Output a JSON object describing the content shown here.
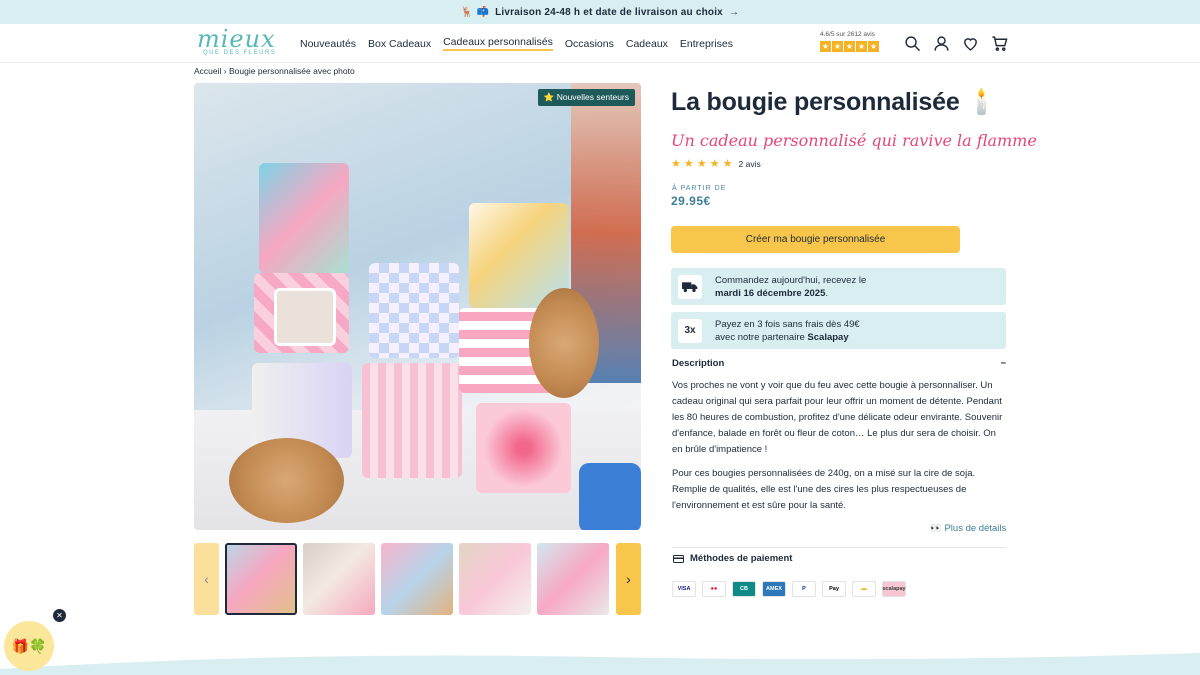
{
  "announcement": {
    "icons": "🦌 📫",
    "text": "Livraison 24-48 h et date de livraison au choix",
    "arrow": "→"
  },
  "header": {
    "logo_word": "mieux",
    "logo_sub": "QUE DES FLEURS",
    "nav": [
      "Nouveautés",
      "Box Cadeaux",
      "Cadeaux personnalisés",
      "Occasions",
      "Cadeaux",
      "Entreprises"
    ],
    "rating_text": "4.6/5 sur 2612 avis",
    "rating_stars": 5,
    "icons": [
      "search-icon",
      "account-icon",
      "heart-icon",
      "cart-icon"
    ]
  },
  "breadcrumb": {
    "home": "Accueil",
    "sep": "›",
    "current": "Bougie personnalisée avec photo"
  },
  "gallery": {
    "badge": "⭐ Nouvelles senteurs",
    "prev": "‹",
    "next": "›",
    "thumbnail_count": 5,
    "selected_index": 0
  },
  "product": {
    "title": "La bougie personnalisée 🕯️",
    "subtitle": "Un cadeau personnalisé qui ravive la flamme",
    "stars": "★ ★ ★ ★ ★",
    "reviews": "2 avis",
    "from_label": "À PARTIR DE",
    "price": "29.95€",
    "cta": "Créer ma bougie personnalisée"
  },
  "delivery": {
    "line1": "Commandez aujourd'hui, recevez le",
    "date": "mardi 16 décembre 2025",
    "suffix": "."
  },
  "payment_split": {
    "icon_text": "3x",
    "line1": "Payez en 3 fois sans frais dès 49€",
    "line2": "avec notre partenaire",
    "partner": "Scalapay"
  },
  "description": {
    "heading": "Description",
    "toggle": "−",
    "p1": "Vos proches ne vont y voir que du feu avec cette bougie à personnaliser. Un cadeau original qui sera parfait pour leur offrir un moment de détente. Pendant les 80 heures de combustion, profitez d'une délicate odeur envirante. Souvenir d'enfance, balade en forêt ou fleur de coton… Le plus dur sera de choisir. On en brûle d'impatience !",
    "p2": "Pour ces bougies personnalisées de 240g, on a misé sur la cire de soja. Remplie de qualités, elle est l'une des cires les plus respectueuses de l'environnement et est sûre pour la santé.",
    "more": "👀 Plus de détails"
  },
  "payment_methods": {
    "heading": "Méthodes de paiement",
    "methods": [
      {
        "name": "VISA",
        "bg": "#ffffff",
        "fg": "#1a1f71"
      },
      {
        "name": "●●",
        "bg": "#ffffff",
        "fg": "#eb001b"
      },
      {
        "name": "CB",
        "bg": "#0f8a86",
        "fg": "#ffffff"
      },
      {
        "name": "AMEX",
        "bg": "#2e77bb",
        "fg": "#ffffff"
      },
      {
        "name": "P",
        "bg": "#ffffff",
        "fg": "#003087"
      },
      {
        "name": "Pay",
        "bg": "#ffffff",
        "fg": "#000000"
      },
      {
        "name": "▬",
        "bg": "#ffffff",
        "fg": "#f0b323"
      },
      {
        "name": "scalapay",
        "bg": "#f7c6d2",
        "fg": "#3b3b3b"
      }
    ]
  },
  "floating": {
    "gift": "🎁🍀",
    "close": "✕"
  },
  "colors": {
    "accent": "#f8c64a",
    "teal": "#57b9b7",
    "light_teal": "#d8eef0",
    "pink": "#e5467a",
    "text": "#1e2a3a"
  }
}
